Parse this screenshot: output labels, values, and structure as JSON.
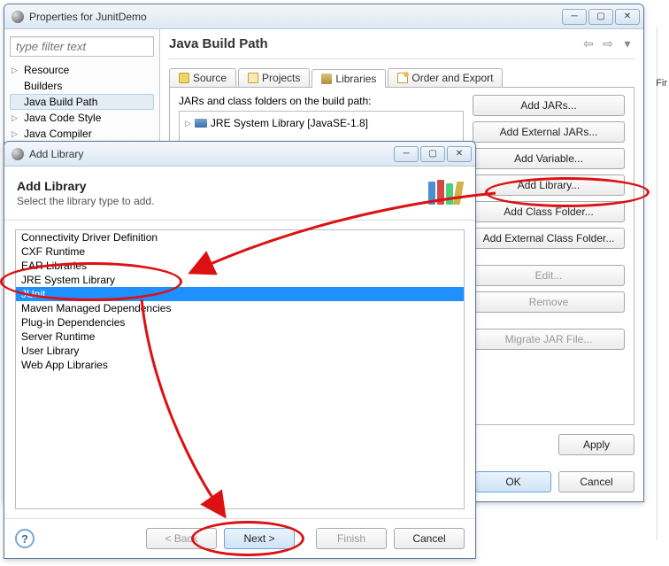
{
  "propertiesWindow": {
    "title": "Properties for JunitDemo",
    "filterPlaceholder": "type filter text",
    "tree": {
      "items": [
        {
          "label": "Resource",
          "expandable": true
        },
        {
          "label": "Builders",
          "expandable": false
        },
        {
          "label": "Java Build Path",
          "expandable": false,
          "selected": true
        },
        {
          "label": "Java Code Style",
          "expandable": true
        },
        {
          "label": "Java Compiler",
          "expandable": true
        }
      ]
    },
    "pageTitle": "Java Build Path",
    "tabs": {
      "source": "Source",
      "projects": "Projects",
      "libraries": "Libraries",
      "orderExport": "Order and Export"
    },
    "listHeading": "JARs and class folders on the build path:",
    "jreEntry": "JRE System Library [JavaSE-1.8]",
    "buttons": {
      "addJars": "Add JARs...",
      "addExtJars": "Add External JARs...",
      "addVariable": "Add Variable...",
      "addLibrary": "Add Library...",
      "addClassFolder": "Add Class Folder...",
      "addExtClassFolder": "Add External Class Folder...",
      "edit": "Edit...",
      "remove": "Remove",
      "migrate": "Migrate JAR File..."
    },
    "apply": "Apply",
    "ok": "OK",
    "cancel": "Cancel"
  },
  "addLibraryDialog": {
    "title": "Add Library",
    "heading": "Add Library",
    "sub": "Select the library type to add.",
    "items": [
      "Connectivity Driver Definition",
      "CXF Runtime",
      "EAR Libraries",
      "JRE System Library",
      "JUnit",
      "Maven Managed Dependencies",
      "Plug-in Dependencies",
      "Server Runtime",
      "User Library",
      "Web App Libraries"
    ],
    "selectedIndex": 4,
    "back": "< Back",
    "next": "Next >",
    "finish": "Finish",
    "cancel": "Cancel"
  },
  "background": {
    "sideLabel": "Fir"
  }
}
